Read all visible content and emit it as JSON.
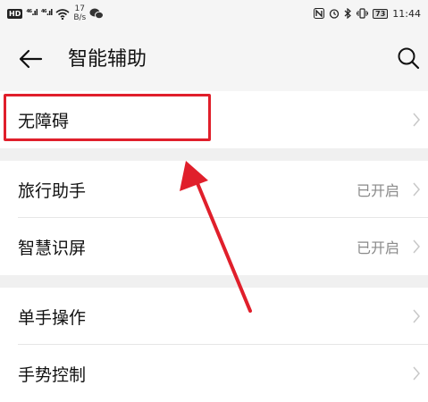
{
  "status_bar": {
    "left_hd": "HD",
    "signal1": "⁴⁶.ıl",
    "signal2": "⁴⁶.ıl",
    "speed_value": "17",
    "speed_unit": "B/s",
    "battery": "73",
    "time": "11:44"
  },
  "header": {
    "title": "智能辅助"
  },
  "groups": [
    {
      "items": [
        {
          "label": "无障碍",
          "status": ""
        }
      ]
    },
    {
      "items": [
        {
          "label": "旅行助手",
          "status": "已开启"
        },
        {
          "label": "智慧识屏",
          "status": "已开启"
        }
      ]
    },
    {
      "items": [
        {
          "label": "单手操作",
          "status": ""
        },
        {
          "label": "手势控制",
          "status": ""
        }
      ]
    }
  ],
  "colors": {
    "annotation_red": "#e01f2b",
    "background": "#f0f0f0"
  }
}
